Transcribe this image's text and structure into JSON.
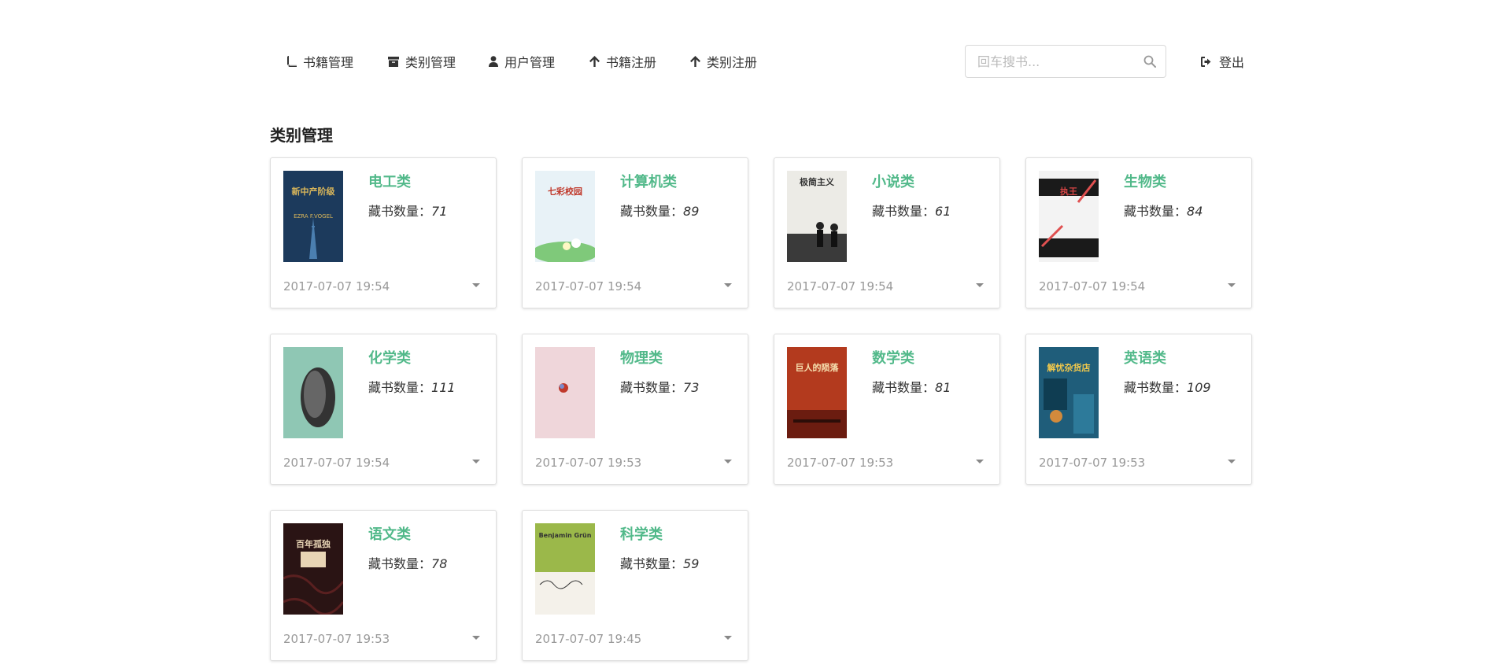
{
  "nav": {
    "items": [
      {
        "label": "书籍管理",
        "icon": "book-icon"
      },
      {
        "label": "类别管理",
        "icon": "archive-icon"
      },
      {
        "label": "用户管理",
        "icon": "user-icon"
      },
      {
        "label": "书籍注册",
        "icon": "arrow-up-icon"
      },
      {
        "label": "类别注册",
        "icon": "arrow-up-icon"
      }
    ],
    "search_placeholder": "回车搜书...",
    "search_value": "",
    "logout_label": "登出"
  },
  "page": {
    "title": "类别管理"
  },
  "categories": [
    {
      "name": "电工类",
      "count_label": "藏书数量：",
      "count": "71",
      "date": "2017-07-07 19:54"
    },
    {
      "name": "计算机类",
      "count_label": "藏书数量：",
      "count": "89",
      "date": "2017-07-07 19:54"
    },
    {
      "name": "小说类",
      "count_label": "藏书数量：",
      "count": "61",
      "date": "2017-07-07 19:54"
    },
    {
      "name": "生物类",
      "count_label": "藏书数量：",
      "count": "84",
      "date": "2017-07-07 19:54"
    },
    {
      "name": "化学类",
      "count_label": "藏书数量：",
      "count": "111",
      "date": "2017-07-07 19:54"
    },
    {
      "name": "物理类",
      "count_label": "藏书数量：",
      "count": "73",
      "date": "2017-07-07 19:53"
    },
    {
      "name": "数学类",
      "count_label": "藏书数量：",
      "count": "81",
      "date": "2017-07-07 19:53"
    },
    {
      "name": "英语类",
      "count_label": "藏书数量：",
      "count": "109",
      "date": "2017-07-07 19:53"
    },
    {
      "name": "语文类",
      "count_label": "藏书数量：",
      "count": "78",
      "date": "2017-07-07 19:53"
    },
    {
      "name": "科学类",
      "count_label": "藏书数量：",
      "count": "59",
      "date": "2017-07-07 19:45"
    }
  ],
  "covers": [
    {
      "title": "新中产阶级",
      "subtitle": "EZRA F.VOGEL",
      "bg": "#1c3a5c",
      "fg": "#d9b65a"
    },
    {
      "title": "七彩校园",
      "subtitle": "",
      "bg": "#e8f2f7",
      "fg": "#c0392b"
    },
    {
      "title": "极简主义",
      "subtitle": "",
      "bg": "#ecebe6",
      "fg": "#333333"
    },
    {
      "title": "执王",
      "subtitle": "",
      "bg": "#f3f3f3",
      "fg": "#d64545"
    },
    {
      "title": "",
      "subtitle": "",
      "bg": "#8fc7b4",
      "fg": "#222222"
    },
    {
      "title": "",
      "subtitle": "",
      "bg": "#efd6da",
      "fg": "#c0392b"
    },
    {
      "title": "巨人的陨落",
      "subtitle": "",
      "bg": "#b33a1e",
      "fg": "#f6e1b0"
    },
    {
      "title": "解忧杂货店",
      "subtitle": "",
      "bg": "#1f5d7a",
      "fg": "#f2c94c"
    },
    {
      "title": "百年孤独",
      "subtitle": "",
      "bg": "#2a1414",
      "fg": "#e8d5b5"
    },
    {
      "title": "Benjamin Grün",
      "subtitle": "",
      "bg": "#9bb84a",
      "fg": "#333333"
    }
  ],
  "colors": {
    "accent": "#52b98a",
    "date": "#999999",
    "border": "#dedede"
  }
}
